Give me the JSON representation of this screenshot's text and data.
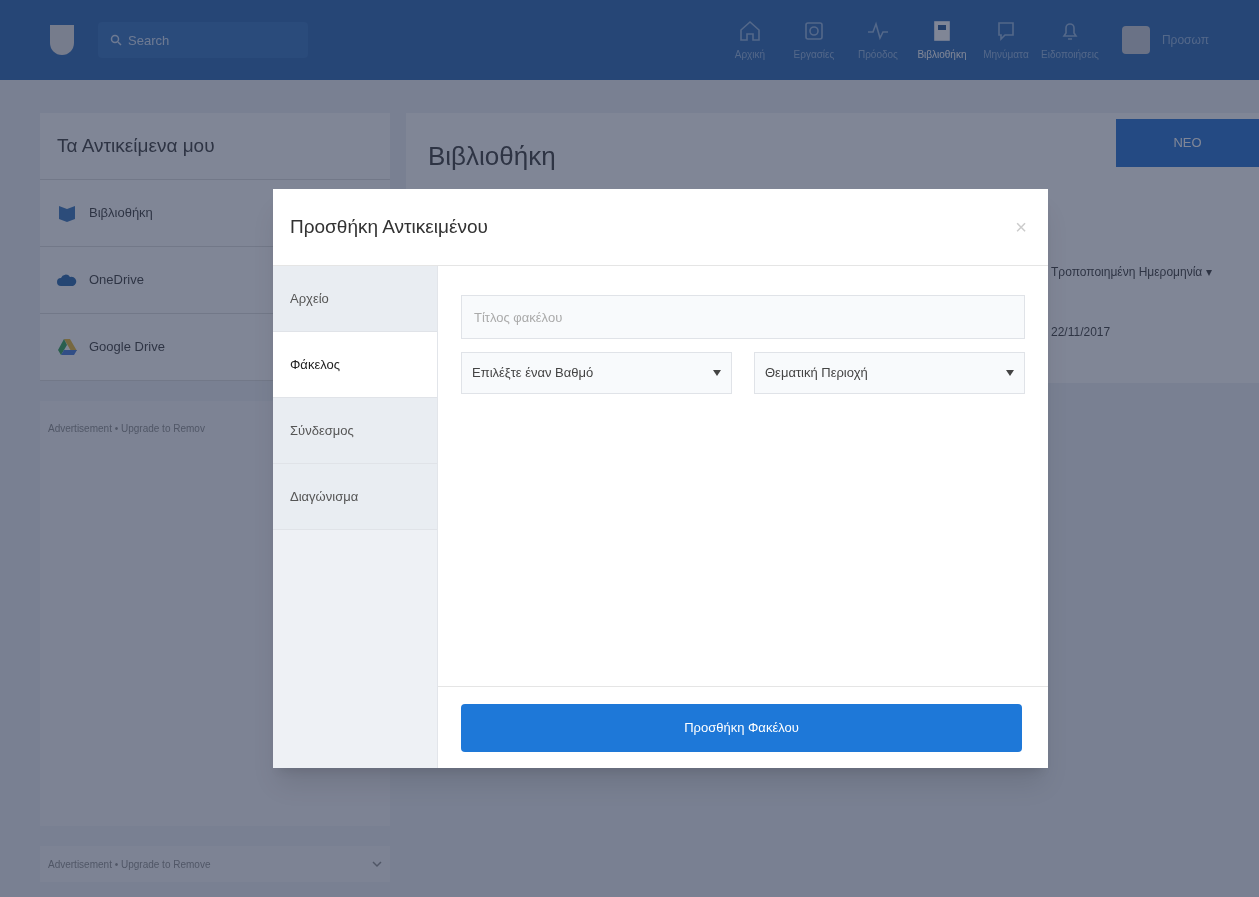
{
  "navbar": {
    "search": {
      "placeholder": "Search"
    },
    "items": [
      {
        "label": "Αρχική",
        "selected": false
      },
      {
        "label": "Εργασίες",
        "selected": false
      },
      {
        "label": "Πρόοδος",
        "selected": false
      },
      {
        "label": "Βιβλιοθήκη",
        "selected": true
      },
      {
        "label": "Μηνύματα",
        "selected": false
      },
      {
        "label": "Ειδοποιήσεις",
        "selected": false
      }
    ],
    "profile_label": "Προσωπ"
  },
  "sidebar": {
    "title": "Τα Αντικείμενα μου",
    "items": [
      {
        "label": "Βιβλιοθήκη"
      },
      {
        "label": "OneDrive"
      },
      {
        "label": "Google Drive"
      }
    ],
    "ads": [
      {
        "text": "Advertisement  •  Upgrade to Remov",
        "kind": "panel"
      },
      {
        "text": "Advertisement  •  Upgrade to Remove",
        "kind": "bar"
      }
    ]
  },
  "main": {
    "title": "Βιβλιοθήκη",
    "new_button": "ΝΕΟ",
    "column_header": "Τροποποιημένη Ημερομηνία ▾",
    "rows": [
      {
        "date": "22/11/2017"
      }
    ]
  },
  "modal": {
    "title": "Προσθήκη Αντικειμένου",
    "close": "×",
    "tabs": [
      {
        "label": "Αρχείο",
        "selected": false
      },
      {
        "label": "Φάκελος",
        "selected": true
      },
      {
        "label": "Σύνδεσμος",
        "selected": false
      },
      {
        "label": "Διαγώνισμα",
        "selected": false
      }
    ],
    "title_field": {
      "placeholder": "Τίτλος φακέλου"
    },
    "selects": [
      {
        "value": "Επιλέξτε έναν Βαθμό"
      },
      {
        "value": "Θεματική Περιοχή"
      }
    ],
    "submit": "Προσθήκη Φακέλου"
  }
}
